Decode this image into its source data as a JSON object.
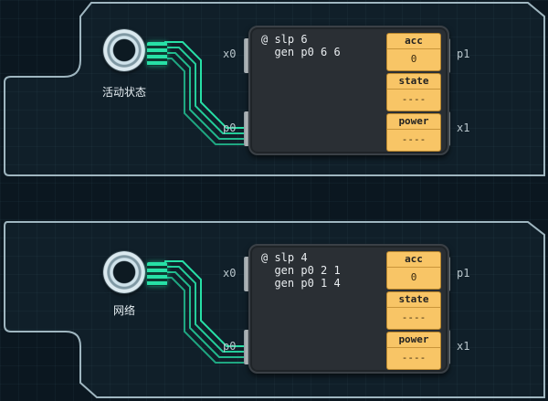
{
  "colors": {
    "accent_trace": "#27e0a6",
    "register_fill": "#f8c566",
    "controller_body": "#2a2f34"
  },
  "panels": [
    {
      "sensor": {
        "label": "活动状态",
        "icon": "sensor-icon"
      },
      "pins": {
        "x0": "x0",
        "p0": "p0",
        "p1": "p1",
        "x1": "x1"
      },
      "code": "@ slp 6\n  gen p0 6 6",
      "registers": [
        {
          "name": "acc",
          "value": "0"
        },
        {
          "name": "state",
          "value": "----"
        },
        {
          "name": "power",
          "value": "----"
        }
      ]
    },
    {
      "sensor": {
        "label": "网络",
        "icon": "sensor-icon"
      },
      "pins": {
        "x0": "x0",
        "p0": "p0",
        "p1": "p1",
        "x1": "x1"
      },
      "code": "@ slp 4\n  gen p0 2 1\n  gen p0 1 4",
      "registers": [
        {
          "name": "acc",
          "value": "0"
        },
        {
          "name": "state",
          "value": "----"
        },
        {
          "name": "power",
          "value": "----"
        }
      ]
    }
  ]
}
